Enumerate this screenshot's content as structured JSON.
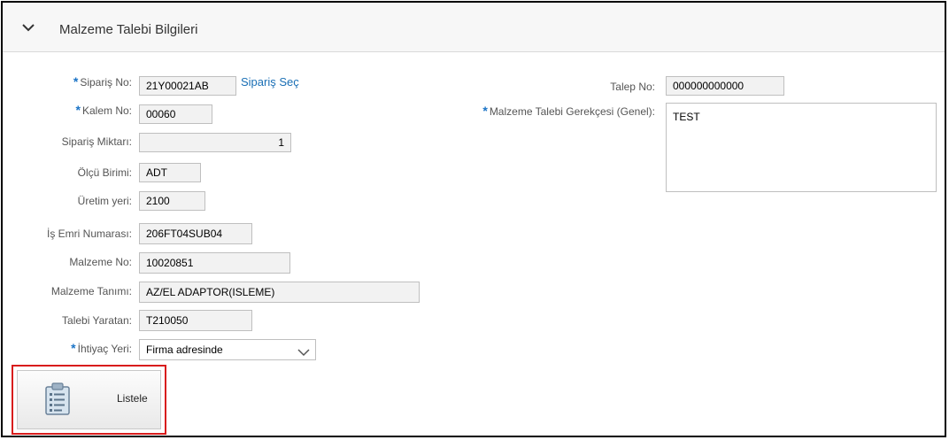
{
  "panel": {
    "title": "Malzeme Talebi Bilgileri"
  },
  "form": {
    "siparis_no": {
      "label": "Sipariş No:",
      "value": "21Y00021AB",
      "link": "Sipariş Seç"
    },
    "kalem_no": {
      "label": "Kalem No:",
      "value": "00060"
    },
    "siparis_miktari": {
      "label": "Sipariş Miktarı:",
      "value": "1"
    },
    "olcu_birimi": {
      "label": "Ölçü Birimi:",
      "value": "ADT"
    },
    "uretim_yeri": {
      "label": "Üretim yeri:",
      "value": "2100"
    },
    "is_emri": {
      "label": "İş Emri Numarası:",
      "value": "206FT04SUB04"
    },
    "malzeme_no": {
      "label": "Malzeme No:",
      "value": "10020851"
    },
    "malzeme_tanimi": {
      "label": "Malzeme Tanımı:",
      "value": "AZ/EL ADAPTOR(ISLEME)"
    },
    "talebi_yaratan": {
      "label": "Talebi Yaratan:",
      "value": "T210050"
    },
    "ihtiyac_yeri": {
      "label": "İhtiyaç Yeri:",
      "value": "Firma adresinde"
    },
    "talep_no": {
      "label": "Talep No:",
      "value": "000000000000"
    },
    "gerekce": {
      "label": "Malzeme Talebi Gerekçesi (Genel):",
      "value": "TEST"
    },
    "required_marker": "*"
  },
  "actions": {
    "list_button": "Listele"
  },
  "colors": {
    "required": "#1a73c6",
    "link": "#1a6fb5",
    "highlight": "#d81c1c"
  },
  "icons": {
    "collapse": "chevron-down-icon",
    "list": "clipboard-list-icon",
    "dropdown": "chevron-down-icon"
  }
}
